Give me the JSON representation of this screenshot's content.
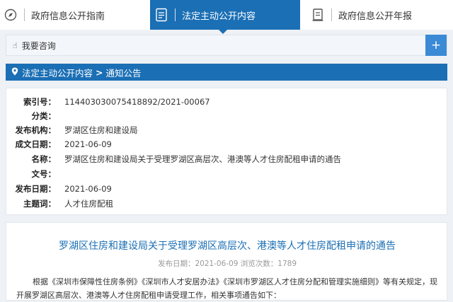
{
  "tabs": [
    {
      "label": "政府信息公开指南",
      "icon": "compass-icon"
    },
    {
      "label": "法定主动公开内容",
      "icon": "document-icon"
    },
    {
      "label": "政府信息公开年报",
      "icon": "report-icon"
    }
  ],
  "consult": {
    "label": "我要咨询",
    "plus": "+"
  },
  "breadcrumb": {
    "part1": "法定主动公开内容",
    "separator": ">",
    "part2": "通知公告"
  },
  "info": {
    "index_no": {
      "key": "索引号：",
      "value": "114403030075418892/2021-00067"
    },
    "category": {
      "key": "分类：",
      "value": ""
    },
    "publisher": {
      "key": "发布机构：",
      "value": "罗湖区住房和建设局"
    },
    "created": {
      "key": "成文日期：",
      "value": "2021-06-09"
    },
    "name": {
      "key": "名称：",
      "value": "罗湖区住房和建设局关于受理罗湖区高层次、港澳等人才住房配租申请的通告"
    },
    "doc_no": {
      "key": "文号：",
      "value": ""
    },
    "published": {
      "key": "发布日期：",
      "value": "2021-06-09"
    },
    "subject": {
      "key": "主题词：",
      "value": "人才住房配租"
    }
  },
  "article": {
    "title": "罗湖区住房和建设局关于受理罗湖区高层次、港澳等人才住房配租申请的通告",
    "meta": "发布日期：2021-06-09  浏览次数：1789",
    "body": "根据《深圳市保障性住房条例》《深圳市人才安居办法》《深圳市罗湖区人才住房分配和管理实施细则》等有关规定，现开展罗湖区高层次、港澳等人才住房配租申请受理工作，相关事项通告如下："
  },
  "colors": {
    "brand_blue": "#1b6fb5",
    "plus_blue": "#3a8ad6",
    "title_blue": "#1b6fb5"
  }
}
